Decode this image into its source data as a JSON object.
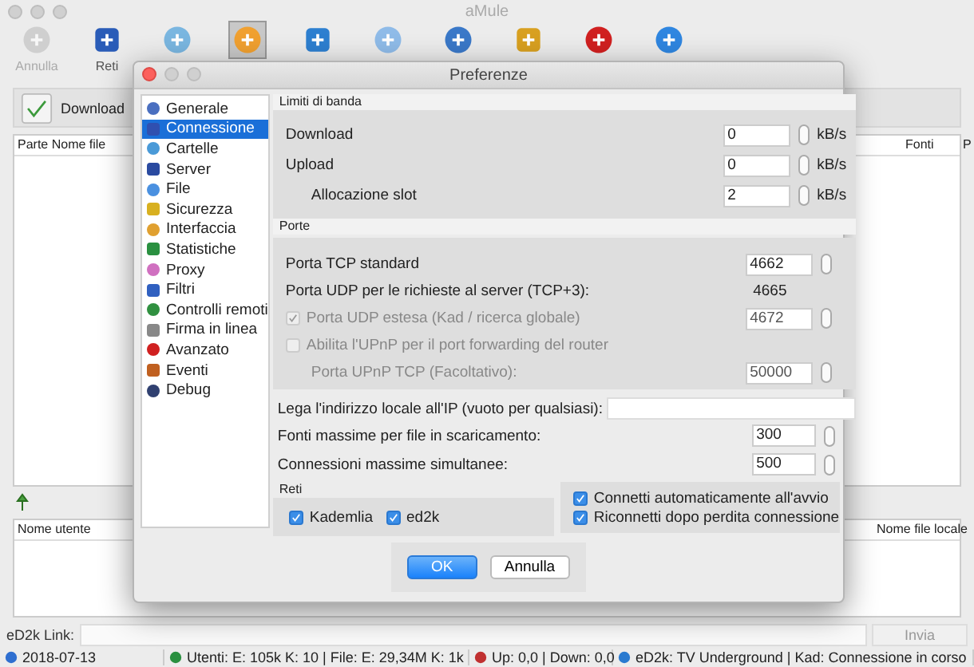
{
  "main_window": {
    "title": "aMule",
    "toolbar": [
      {
        "label": "Annulla",
        "disabled": true,
        "selected": false
      },
      {
        "label": "Reti",
        "disabled": false,
        "selected": false
      },
      {
        "disabled": false,
        "selected": false
      },
      {
        "disabled": false,
        "selected": true
      },
      {
        "disabled": false,
        "selected": false
      },
      {
        "disabled": false,
        "selected": false
      },
      {
        "disabled": false,
        "selected": false
      },
      {
        "disabled": false,
        "selected": false
      },
      {
        "disabled": false,
        "selected": false
      },
      {
        "disabled": false,
        "selected": false
      }
    ],
    "download_bar": {
      "label": "Download"
    },
    "transfers_table": {
      "columns": [
        "Parte Nome file",
        "Fonti",
        "P"
      ]
    },
    "uploads_table": {
      "columns": [
        "Nome utente",
        "Nome file locale"
      ]
    },
    "ed2k_link": {
      "label": "eD2k Link:",
      "button": "Invia"
    },
    "status_bar": [
      "2018-07-13",
      "Utenti: E: 105k K: 10 | File: E: 29,34M K: 1k",
      "Up: 0,0 | Down: 0,0",
      "eD2k: TV Underground | Kad: Connessione in corso"
    ]
  },
  "dialog": {
    "title": "Preferenze",
    "categories": [
      {
        "label": "Generale",
        "selected": false
      },
      {
        "label": "Connessione",
        "selected": true
      },
      {
        "label": "Cartelle",
        "selected": false
      },
      {
        "label": "Server",
        "selected": false
      },
      {
        "label": "File",
        "selected": false
      },
      {
        "label": "Sicurezza",
        "selected": false
      },
      {
        "label": "Interfaccia",
        "selected": false
      },
      {
        "label": "Statistiche",
        "selected": false
      },
      {
        "label": "Proxy",
        "selected": false
      },
      {
        "label": "Filtri",
        "selected": false
      },
      {
        "label": "Controlli remoti",
        "selected": false
      },
      {
        "label": "Firma in linea",
        "selected": false
      },
      {
        "label": "Avanzato",
        "selected": false
      },
      {
        "label": "Eventi",
        "selected": false
      },
      {
        "label": "Debug",
        "selected": false
      }
    ],
    "bandwidth": {
      "title": "Limiti di banda",
      "rows": [
        {
          "kind": "main",
          "label": "Download",
          "value": "0",
          "unit": "kB/s"
        },
        {
          "kind": "main",
          "label": "Upload",
          "value": "0",
          "unit": "kB/s"
        },
        {
          "kind": "sub",
          "label": "Allocazione slot",
          "value": "2",
          "unit": "kB/s"
        }
      ]
    },
    "ports": {
      "title": "Porte",
      "rows": [
        {
          "kind": "spin",
          "label": "Porta TCP standard",
          "value": "4662",
          "disabled": false
        },
        {
          "kind": "readout",
          "label": "Porta UDP per le richieste al server (TCP+3):",
          "value": "4665"
        },
        {
          "kind": "check",
          "label": "Porta UDP estesa (Kad / ricerca globale)",
          "checked": true,
          "disabled": true,
          "value": "4672"
        },
        {
          "kind": "check",
          "label": "Abilita l'UPnP per il port forwarding del router",
          "checked": false,
          "disabled": true
        },
        {
          "kind": "subspin",
          "label": "Porta UPnP TCP (Facoltativo):",
          "value": "50000",
          "disabled": true
        }
      ]
    },
    "bind_ip": {
      "label": "Lega l'indirizzo locale all'IP (vuoto per qualsiasi):"
    },
    "limits": [
      {
        "label": "Fonti massime per file in scaricamento:",
        "value": "300"
      },
      {
        "label": "Connessioni massime simultanee:",
        "value": "500"
      }
    ],
    "networks": {
      "title": "Reti",
      "options": [
        {
          "label": "Kademlia",
          "checked": true
        },
        {
          "label": "ed2k",
          "checked": true
        }
      ]
    },
    "connect_options": [
      {
        "label": "Connetti automaticamente all'avvio",
        "checked": true
      },
      {
        "label": "Riconnetti dopo perdita connessione",
        "checked": true
      }
    ],
    "buttons": [
      {
        "label": "OK",
        "default": true
      },
      {
        "label": "Annulla",
        "default": false
      }
    ]
  }
}
